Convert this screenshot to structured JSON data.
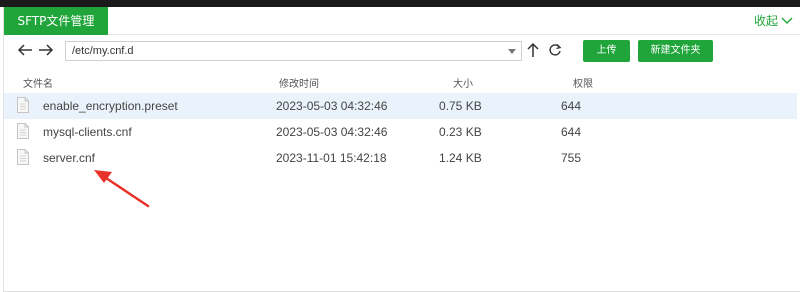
{
  "header": {
    "tab_label": "SFTP文件管理",
    "collapse_label": "收起"
  },
  "toolbar": {
    "path": "/etc/my.cnf.d",
    "upload_label": "上传",
    "new_folder_label": "新建文件夹"
  },
  "columns": {
    "name": "文件名",
    "modified": "修改时间",
    "size": "大小",
    "permission": "权限"
  },
  "files": [
    {
      "name": "enable_encryption.preset",
      "modified": "2023-05-03 04:32:46",
      "size": "0.75 KB",
      "permission": "644",
      "selected": true
    },
    {
      "name": "mysql-clients.cnf",
      "modified": "2023-05-03 04:32:46",
      "size": "0.23 KB",
      "permission": "644",
      "selected": false
    },
    {
      "name": "server.cnf",
      "modified": "2023-11-01 15:42:18",
      "size": "1.24 KB",
      "permission": "755",
      "selected": false
    }
  ],
  "colors": {
    "accent": "#20a53a",
    "selected_row": "#eaf3fb",
    "annotation_arrow": "#e8332a"
  },
  "icons": [
    "arrow-left-icon",
    "arrow-right-icon",
    "arrow-up-icon",
    "refresh-icon",
    "chevron-down-icon",
    "file-icon"
  ]
}
